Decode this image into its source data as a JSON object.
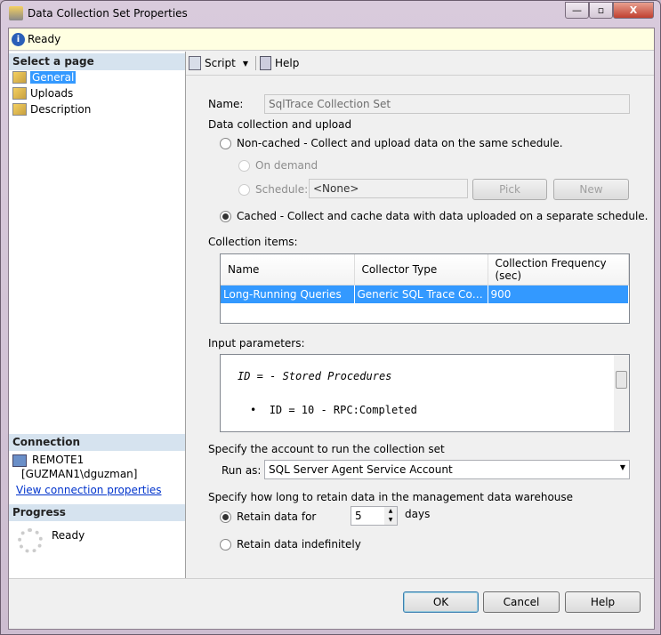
{
  "window": {
    "title": "Data Collection Set Properties",
    "minimize": "—",
    "maximize": "▫",
    "close": "X"
  },
  "status": {
    "text": "Ready"
  },
  "left": {
    "select_header": "Select a page",
    "pages": [
      "General",
      "Uploads",
      "Description"
    ],
    "connection_header": "Connection",
    "server": "REMOTE1",
    "user": "[GUZMAN1\\dguzman]",
    "view_link": "View connection properties",
    "progress_header": "Progress",
    "progress_text": "Ready"
  },
  "toolbar": {
    "script": "Script",
    "help": "Help"
  },
  "form": {
    "name_label": "Name:",
    "name_value": "SqlTrace Collection Set",
    "collection_group": "Data collection and upload",
    "noncached": "Non-cached - Collect and upload data on the same schedule.",
    "on_demand": "On demand",
    "schedule": "Schedule:",
    "schedule_value": "<None>",
    "pick": "Pick",
    "new": "New",
    "cached": "Cached - Collect and cache data with data uploaded on a separate schedule.",
    "items_label": "Collection items:",
    "columns": [
      "Name",
      "Collector Type",
      "Collection Frequency (sec)"
    ],
    "rows": [
      [
        "Long-Running Queries",
        "Generic SQL Trace Collec...",
        "900"
      ]
    ],
    "input_label": "Input parameters:",
    "param_line1": "ID =  - Stored Procedures",
    "param_line2": "ID = 10 - RPC:Completed",
    "account_label": "Specify the account to run the collection set",
    "runas_label": "Run as:",
    "runas_value": "SQL Server Agent Service Account",
    "retain_label": "Specify how long to retain data in the management data warehouse",
    "retain_for": "Retain data for",
    "retain_value": "5",
    "days": "days",
    "retain_indef": "Retain data indefinitely"
  },
  "buttons": {
    "ok": "OK",
    "cancel": "Cancel",
    "help": "Help"
  }
}
